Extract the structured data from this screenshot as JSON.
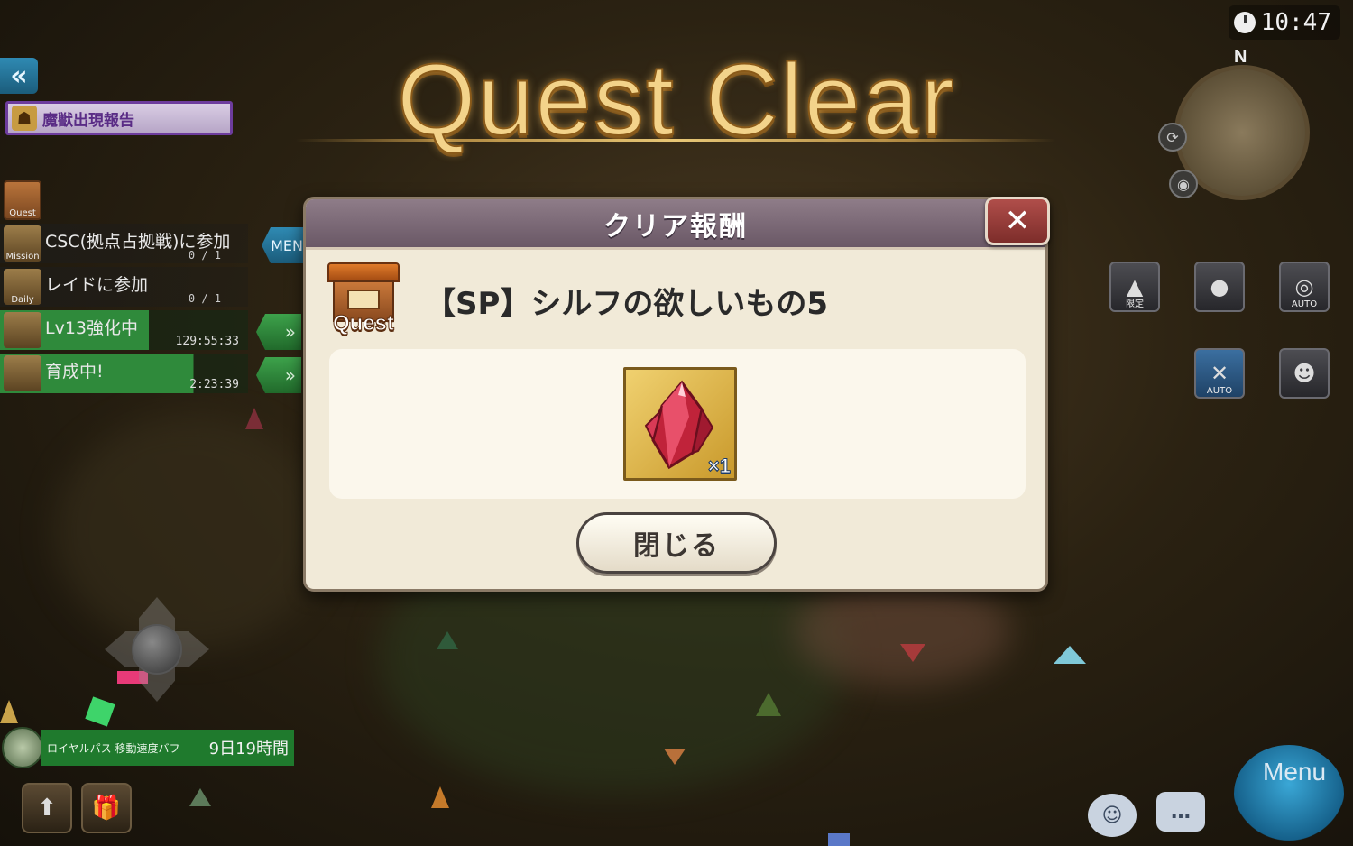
{
  "clock": {
    "time": "10:47"
  },
  "minimap": {
    "north_label": "N"
  },
  "header": {
    "quest_clear_title": "Quest Clear"
  },
  "left_hud": {
    "report_label": "魔獣出現報告",
    "quest_icon_label": "Quest",
    "menu_tab_label": "MEN",
    "tasks": [
      {
        "icon_label": "Mission",
        "label": "CSC(拠点占拠戦)に参加",
        "progress": "0 / 1"
      },
      {
        "icon_label": "Daily",
        "label": "レイドに参加",
        "progress": "0 / 1"
      },
      {
        "label": "Lv13強化中",
        "time": "129:55:33"
      },
      {
        "label": "育成中!",
        "time": "2:23:39"
      }
    ],
    "buff": {
      "name": "ロイヤルパス 移動速度バフ",
      "time": "9日19時間"
    }
  },
  "right_hud": {
    "limited_label": "限定",
    "auto_label": "AUTO",
    "menu_label": "Menu"
  },
  "dialog": {
    "title": "クリア報酬",
    "quest_badge_label": "Quest",
    "quest_name": "【SP】シルフの欲しいもの5",
    "reward": {
      "icon": "red-crystal-icon",
      "quantity": "×1"
    },
    "close_button_label": "閉じる"
  },
  "colors": {
    "title_gold": "#f3d38a",
    "dialog_header": "#7a6876",
    "close_red": "#9a3c38",
    "progress_green": "#2f8a3b"
  }
}
